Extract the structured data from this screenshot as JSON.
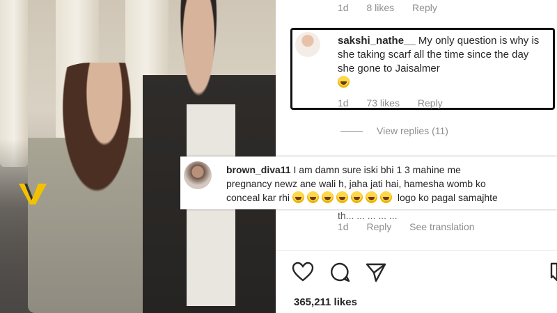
{
  "top_meta": {
    "time": "1d",
    "likes": "8 likes",
    "reply": "Reply"
  },
  "comment1": {
    "username": "sakshi_nathe__",
    "text": "My only question is why is she taking scarf all the time since the day she gone to Jaisalmer",
    "time": "1d",
    "likes": "73 likes",
    "reply": "Reply"
  },
  "view_replies": "View replies (11)",
  "comment2": {
    "username": "brown_diva11",
    "line1": "I am damn sure iski bhi 1 3 mahine me",
    "line2": "pregnancy newz ane wali h, jaha jati hai, hamesha womb ko",
    "line3_start": "conceal kar rhi",
    "line3_end": "logo ko pagal samajhte",
    "hidden_text": "th... ... ... ... ...",
    "time": "1d",
    "reply": "Reply",
    "see_translation": "See translation"
  },
  "post": {
    "likes": "365,211 likes"
  },
  "icons": [
    "heart-icon",
    "comment-icon",
    "share-icon",
    "bookmark-icon"
  ]
}
